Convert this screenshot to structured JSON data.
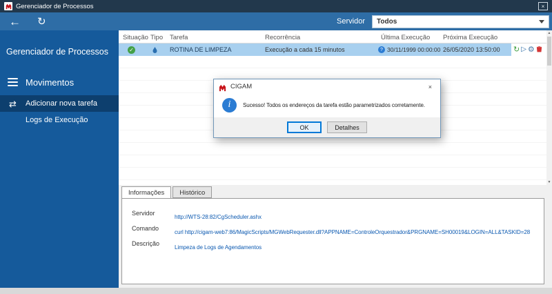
{
  "window": {
    "title": "Gerenciador de Processos",
    "close_glyph": "×"
  },
  "toolbar": {
    "back_glyph": "←",
    "refresh_glyph": "↻",
    "server_label": "Servidor",
    "server_selected": "Todos"
  },
  "sidebar": {
    "title": "Gerenciador de Processos",
    "section_label": "Movimentos",
    "items": [
      {
        "label": "Adicionar nova tarefa",
        "glyph": "⇄",
        "active": true
      },
      {
        "label": "Logs de Execução",
        "glyph": "",
        "active": false
      }
    ]
  },
  "tasks_table": {
    "columns": [
      "Situação",
      "Tipo",
      "Tarefa",
      "Recorrência",
      "Última Execução",
      "Próxima Execução"
    ],
    "row": {
      "status_glyph": "✓",
      "tarefa": "ROTINA DE LIMPEZA",
      "recorrencia": "Execução a cada 15 minutos",
      "ultima_flag_glyph": "?",
      "ultima_execucao": "30/11/1999 00:00:00",
      "proxima_execucao": "26/05/2020 13:50:00",
      "run_glyph": "↻",
      "play_glyph": "▷",
      "settings_glyph": "⚙"
    }
  },
  "scrollbar": {
    "up_glyph": "▲",
    "down_glyph": "▼"
  },
  "dialog": {
    "title": "CIGAM",
    "close_glyph": "×",
    "info_glyph": "i",
    "message": "Sucesso! Todos os endereços da tarefa estão parametrizados corretamente.",
    "ok_label": "OK",
    "details_label": "Detalhes"
  },
  "details_panel": {
    "tabs": [
      {
        "label": "Informações",
        "active": true
      },
      {
        "label": "Histórico",
        "active": false
      }
    ],
    "fields": [
      {
        "label": "Servidor",
        "value": "http://WTS-28:82/CgScheduler.ashx"
      },
      {
        "label": "Comando",
        "value": "curl http://cigam-web7:86/MagicScripts/MGWebRequester.dll?APPNAME=ControleOrquestrador&PRGNAME=SH00019&LOGIN=ALL&TASKID=28"
      },
      {
        "label": "Descrição",
        "value": "Limpeza de Logs de Agendamentos"
      }
    ]
  },
  "colors": {
    "titlebar": "#22384c",
    "toolbar_blue": "#2e6da6",
    "sidebar_blue": "#155a9b",
    "sidebar_active": "#0d3f6e",
    "row_selection": "#a8d0ef",
    "link_blue": "#0a58b0",
    "accent": "#0078d7",
    "logo_red": "#c8151b",
    "success_green": "#43a047",
    "danger_red": "#d43535"
  }
}
